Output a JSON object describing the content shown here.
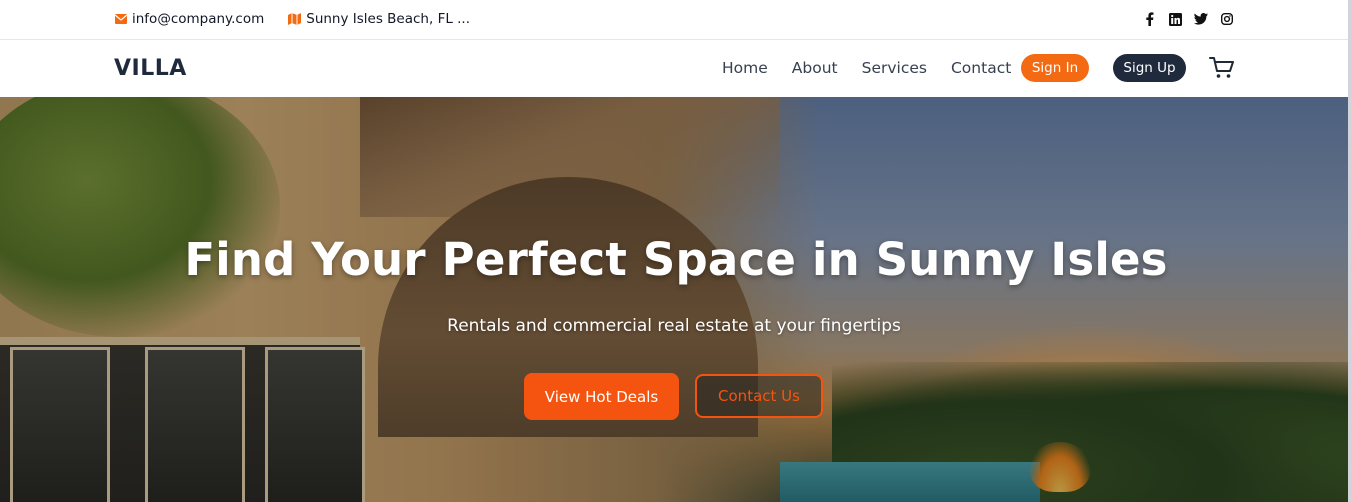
{
  "topbar": {
    "email": "info@company.com",
    "location": "Sunny Isles Beach, FL ...",
    "social_icons": [
      "facebook-icon",
      "linkedin-icon",
      "twitter-icon",
      "instagram-icon"
    ],
    "icon_color": "#f46a12"
  },
  "navbar": {
    "brand": "VILLA",
    "links": [
      "Home",
      "About",
      "Services",
      "Contact"
    ],
    "sign_in": "Sign In",
    "sign_up": "Sign Up",
    "cart_icon": "cart-icon"
  },
  "hero": {
    "title": "Find Your Perfect Space in Sunny Isles",
    "subtitle": "Rentals and commercial real estate at your fingertips",
    "primary_button": "View Hot Deals",
    "secondary_button": "Contact Us"
  },
  "colors": {
    "accent": "#f45410",
    "dark": "#1f2a3d"
  }
}
